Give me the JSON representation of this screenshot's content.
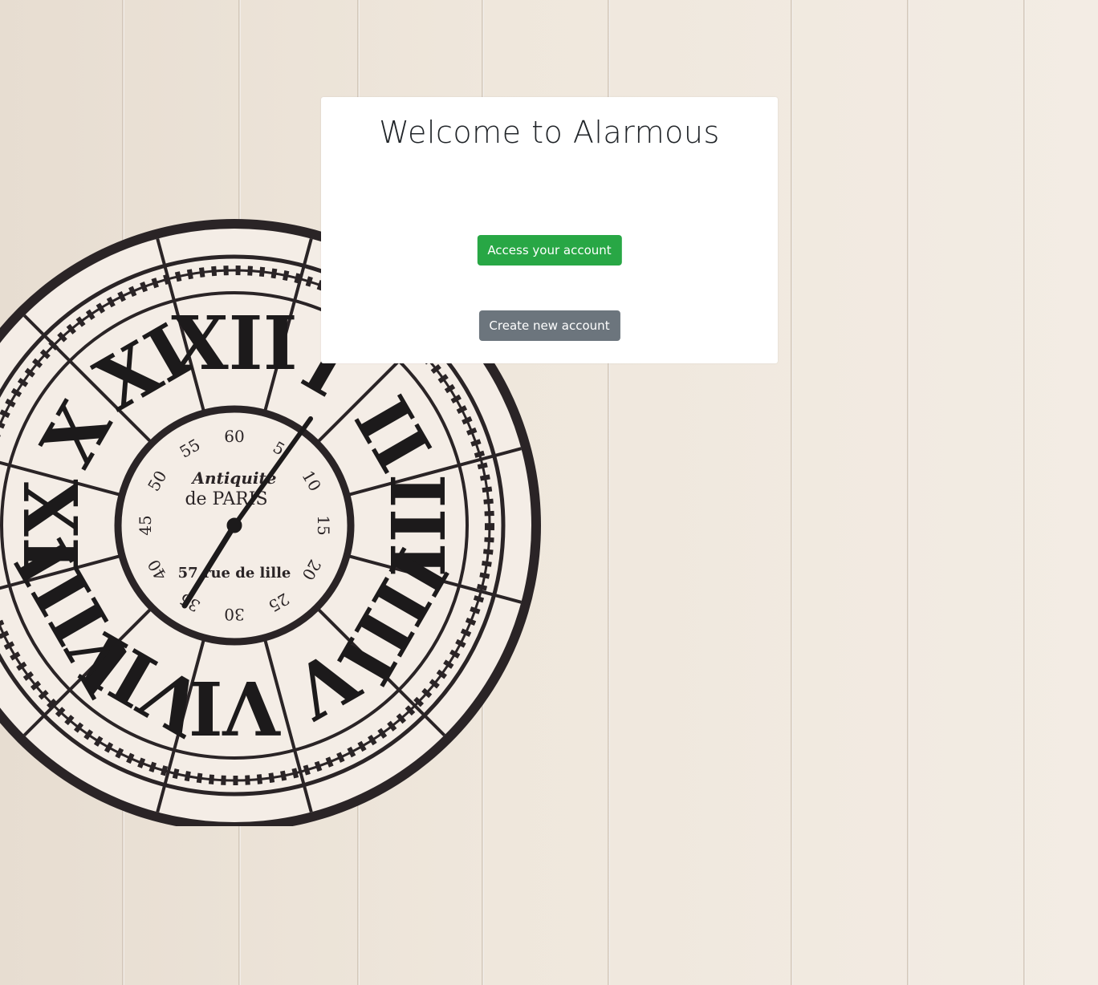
{
  "page": {
    "title": "Welcome to Alarmous"
  },
  "actions": {
    "access_label": "Access your account",
    "create_label": "Create new account"
  },
  "background": {
    "clock_brand": "Antiquite",
    "clock_city": "de PARIS",
    "clock_address": "57 rue de lille",
    "clock_minute_marks": [
      "60",
      "5",
      "10",
      "15",
      "20",
      "25",
      "30",
      "35",
      "40",
      "45",
      "50",
      "55"
    ],
    "clock_roman_numerals": [
      "XII",
      "I",
      "II",
      "III",
      "IIII",
      "V",
      "VI",
      "VII",
      "VIII",
      "IX",
      "X",
      "XI"
    ]
  },
  "colors": {
    "success": "#28a745",
    "secondary": "#6c757d",
    "card": "#ffffff",
    "wall": "#ece4da"
  }
}
